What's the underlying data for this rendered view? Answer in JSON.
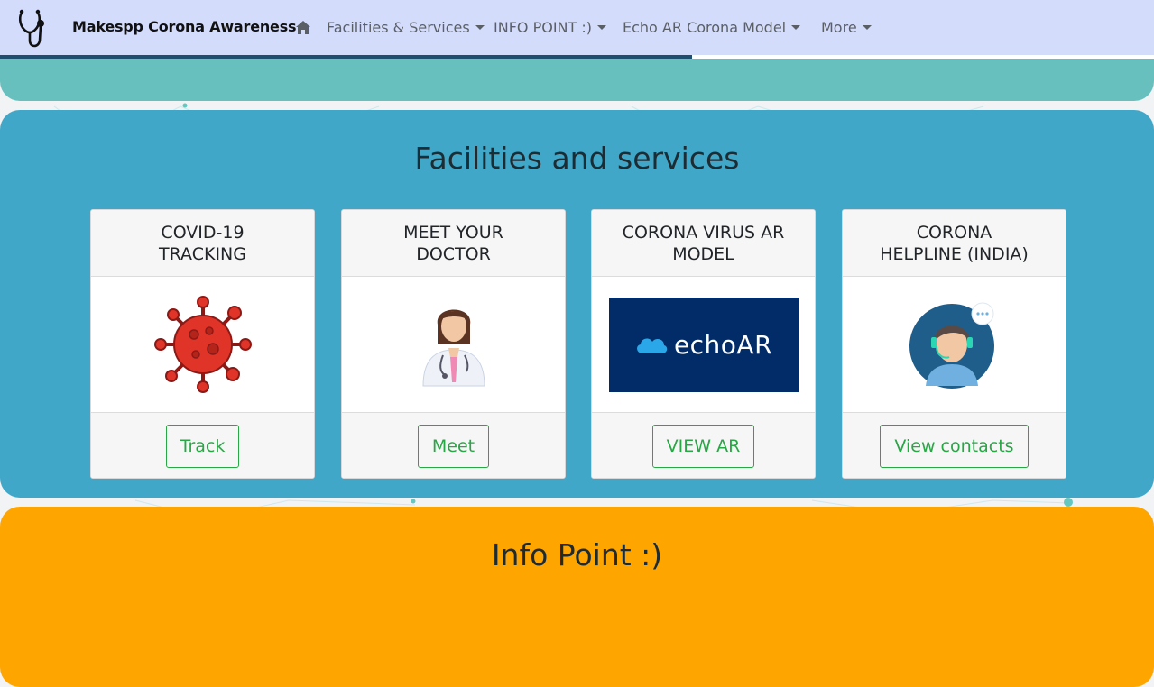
{
  "navbar": {
    "brand": "Makespp Corona Awareness",
    "items": [
      {
        "label": "Facilities & Services",
        "dropdown": true
      },
      {
        "label": "INFO POINT :)",
        "dropdown": true
      },
      {
        "label": "Echo AR Corona Model",
        "dropdown": true
      },
      {
        "label": "More",
        "dropdown": true
      }
    ],
    "scroll_progress": 0.6
  },
  "facilities": {
    "title": "Facilities and services",
    "cards": [
      {
        "title": "COVID-19 TRACKING",
        "icon": "virus-icon",
        "button": "Track"
      },
      {
        "title": "MEET YOUR DOCTOR",
        "icon": "doctor-icon",
        "button": "Meet"
      },
      {
        "title": "CORONA VIRUS AR MODEL",
        "icon": "echoar-logo",
        "logo_text": "echoAR",
        "button": "VIEW AR"
      },
      {
        "title": "CORONA HELPLINE (INDIA)",
        "icon": "helpline-agent-icon",
        "button": "View contacts"
      }
    ]
  },
  "infopoint": {
    "title": "Info Point :)"
  },
  "colors": {
    "navbar": "#d4dcfc",
    "top_section": "#67c0bd",
    "facilities_bg": "#41a7c8",
    "infopoint_bg": "#ffa500",
    "button_green": "#28a745"
  }
}
